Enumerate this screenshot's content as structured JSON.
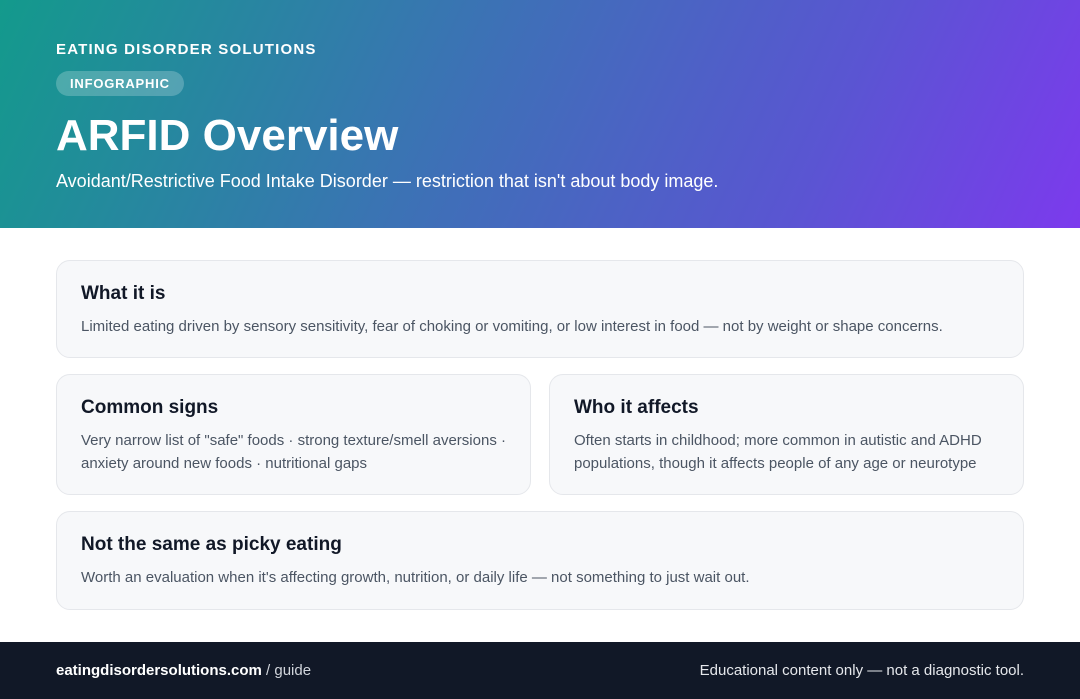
{
  "header": {
    "brand": "EATING DISORDER SOLUTIONS",
    "tag": "INFOGRAPHIC",
    "title": "ARFID Overview",
    "subtitle": "Avoidant/Restrictive Food Intake Disorder — restriction that isn't about body image."
  },
  "cards": [
    {
      "title": "What it is",
      "body": "Limited eating driven by sensory sensitivity, fear of choking or vomiting, or low interest in food — not by weight or shape concerns."
    },
    {
      "title": "Common signs",
      "body": "Very narrow list of \"safe\" foods · strong texture/smell aversions · anxiety around new foods · nutritional gaps"
    },
    {
      "title": "Who it affects",
      "body": "Often starts in childhood; more common in autistic and ADHD populations, though it affects people of any age or neurotype"
    },
    {
      "title": "Not the same as picky eating",
      "body": "Worth an evaluation when it's affecting growth, nutrition, or daily life — not something to just wait out."
    }
  ],
  "footer": {
    "domain": "eatingdisordersolutions.com",
    "separator": " / guide",
    "disclaimer": "Educational content only — not a diagnostic tool."
  },
  "colors": {
    "gradient_start": "#139a8c",
    "gradient_end": "#7c3aed",
    "footer_bg": "#111827",
    "card_bg": "#f7f8fa"
  }
}
